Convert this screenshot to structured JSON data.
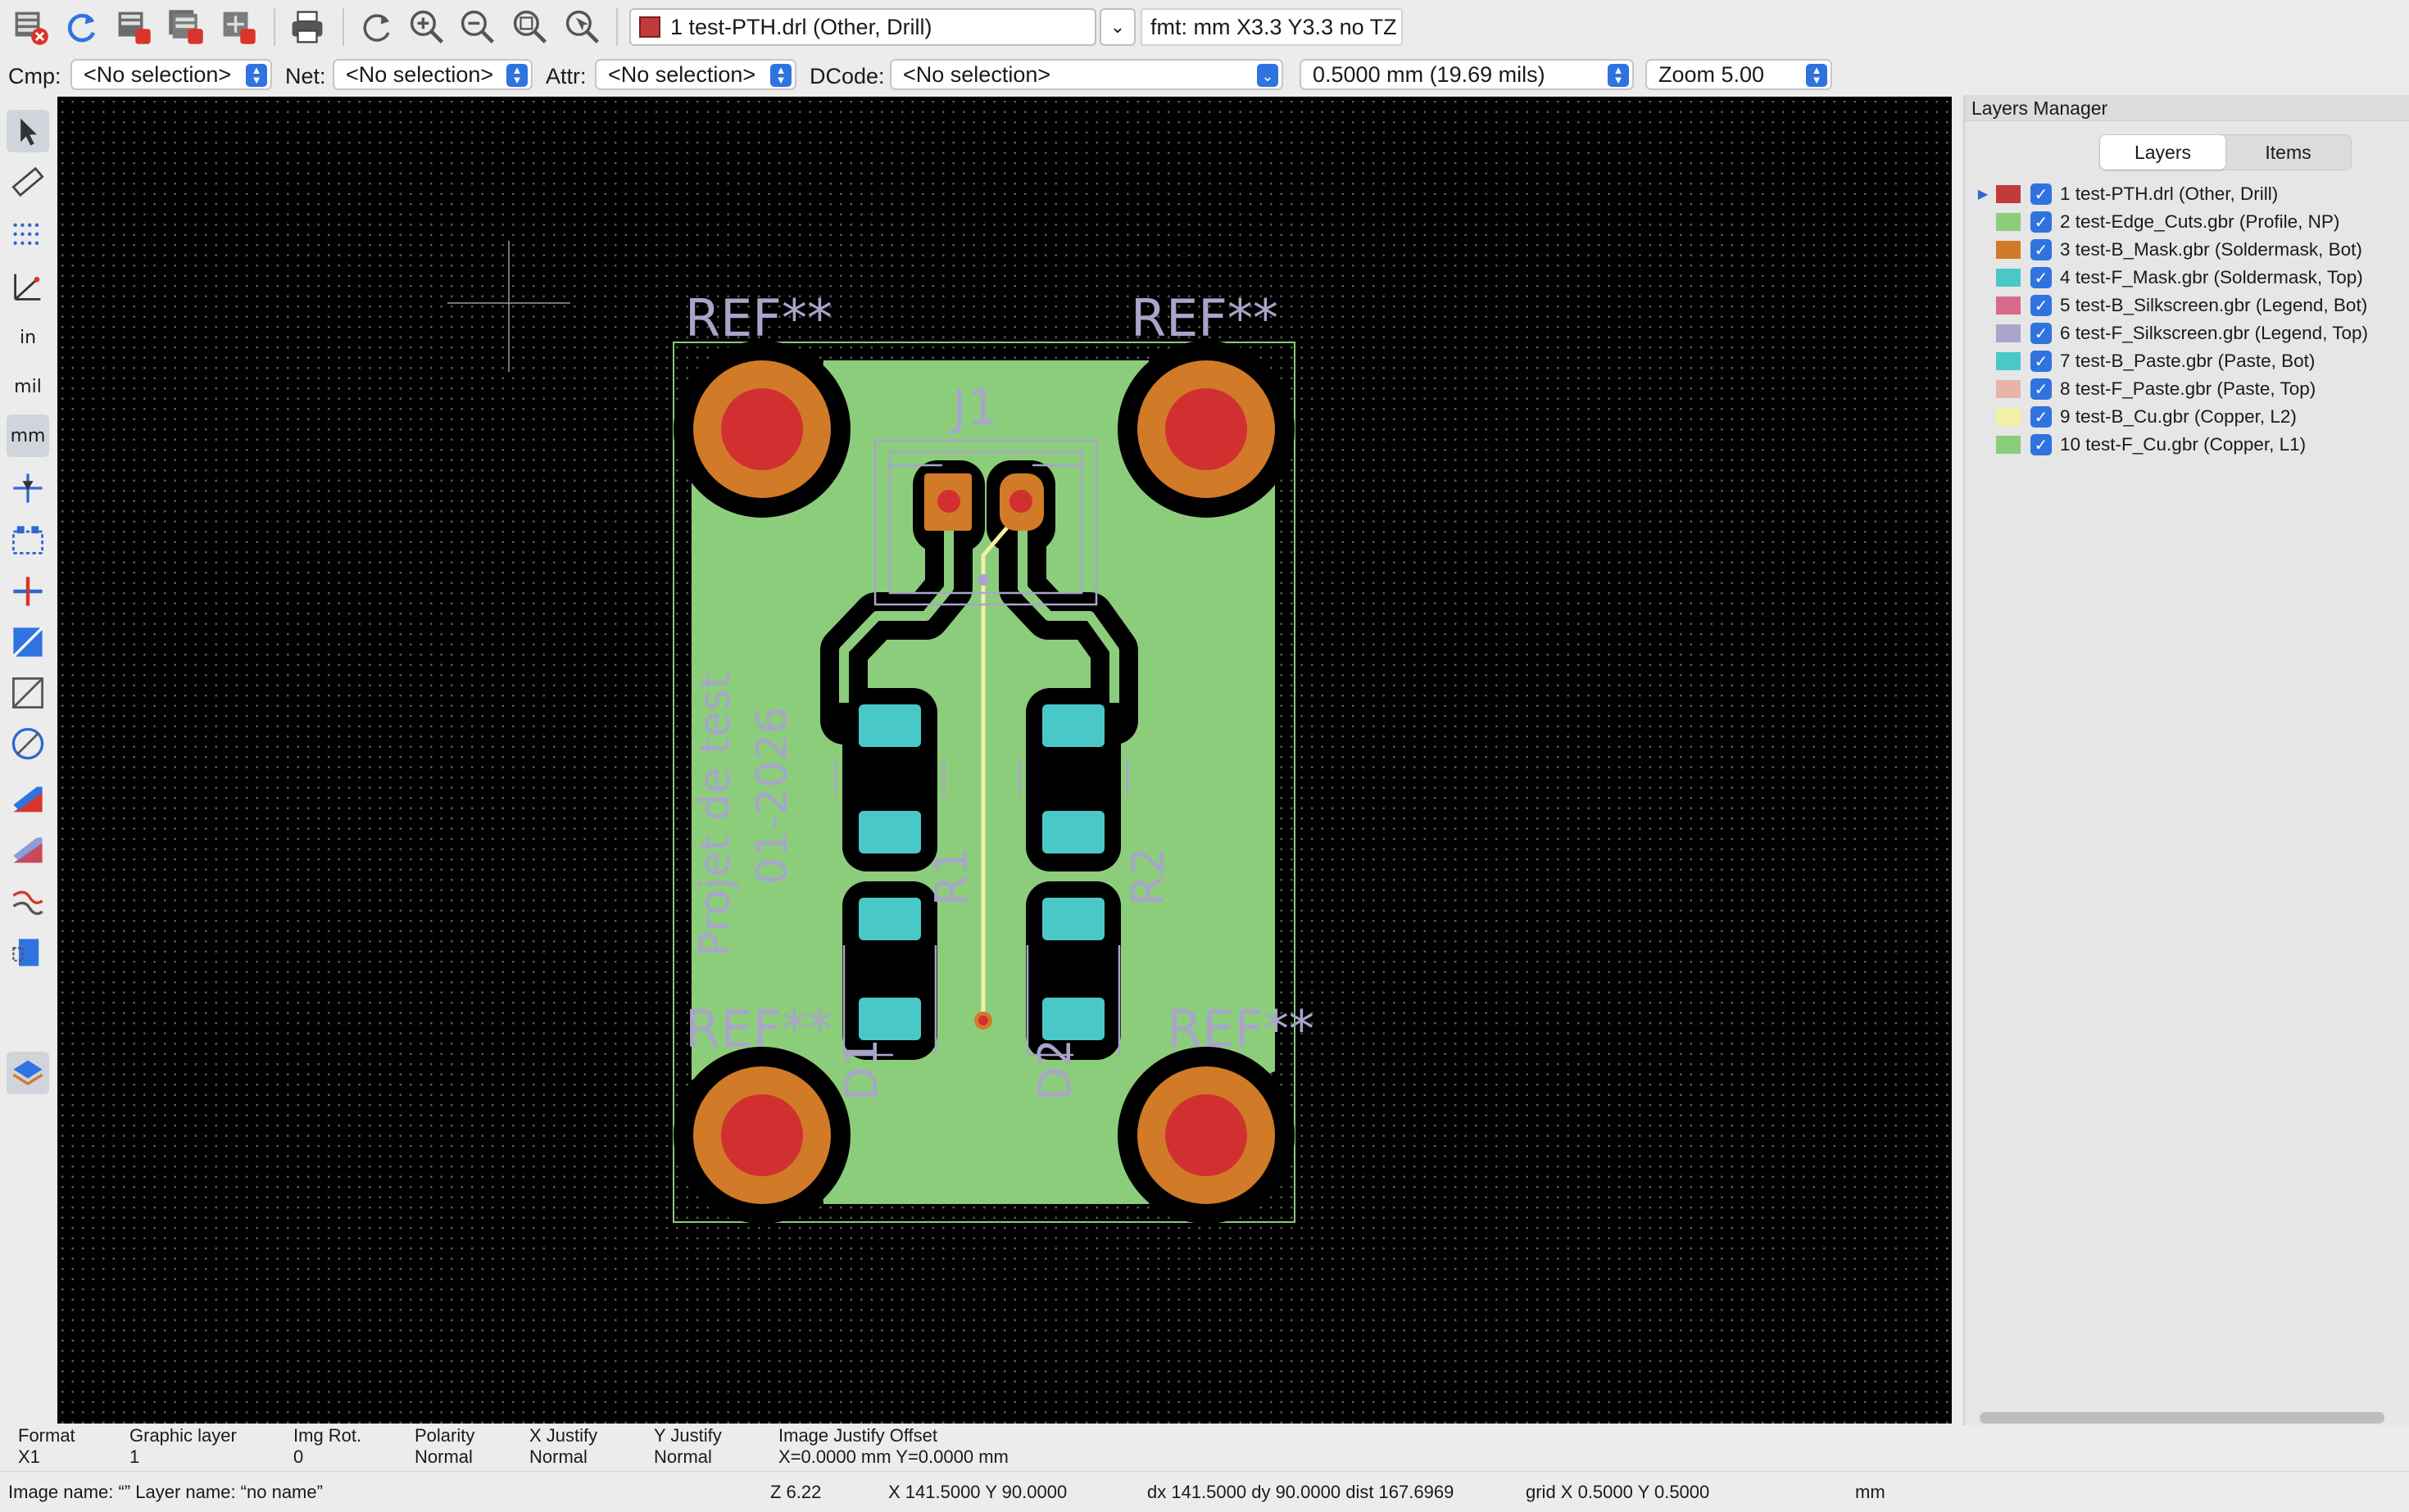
{
  "toolbar": {
    "layer_select": "1 test-PTH.drl (Other, Drill)",
    "layer_select_color": "#c23b3b",
    "format_info": "fmt: mm X3.3 Y3.3 no TZ",
    "icons": [
      "clear-and-load-icon",
      "reload-icon",
      "close-layer-icon",
      "close-all-layers-icon",
      "plot-icon",
      "print-icon",
      "redraw-icon",
      "zoom-in-icon",
      "zoom-out-icon",
      "zoom-fit-icon",
      "zoom-selection-icon"
    ]
  },
  "selbar": {
    "cmp_label": "Cmp:",
    "cmp_value": "<No selection>",
    "net_label": "Net:",
    "net_value": "<No selection>",
    "attr_label": "Attr:",
    "attr_value": "<No selection>",
    "dcode_label": "DCode:",
    "dcode_value": "<No selection>",
    "grid_value": "0.5000 mm (19.69 mils)",
    "zoom_value": "Zoom 5.00"
  },
  "left_toolbar": {
    "units_in": "in",
    "units_mil": "mil",
    "units_mm": "mm",
    "icons": [
      "select-arrow-icon",
      "measure-ruler-icon",
      "grid-dots-icon",
      "polar-coords-icon",
      "inches-icon",
      "mils-icon",
      "millimeters-icon",
      "cursor-crosshair-icon",
      "dcode-icon",
      "negative-objects-icon",
      "flashed-items-icon",
      "lines-sketch-icon",
      "polygons-sketch-icon",
      "diff-mode-icon",
      "transparency-icon",
      "show-layer-icon",
      "show-dcode-icon",
      "layers-manager-icon"
    ]
  },
  "pcb": {
    "ref_tl": "REF**",
    "ref_tr": "REF**",
    "ref_bl": "REF**",
    "ref_br": "REF**",
    "j1": "J1",
    "r1": "R1",
    "r2": "R2",
    "d1": "D1",
    "d2": "D2",
    "project_line1": "Projet de test",
    "project_line2": "01-2026",
    "colors": {
      "drill": "#d23030",
      "edge": "#8ccd7c",
      "bmask": "#d17a28",
      "fmask": "#4ac8c8",
      "silk": "#a8a5c9",
      "bcu": "#f2f0a6",
      "fcu": "#8ccd7c"
    }
  },
  "layers_manager": {
    "title": "Layers Manager",
    "tab_layers": "Layers",
    "tab_items": "Items",
    "layers": [
      {
        "label": "1 test-PTH.drl (Other, Drill)",
        "color": "#c23b3b",
        "active": true
      },
      {
        "label": "2 test-Edge_Cuts.gbr (Profile, NP)",
        "color": "#8ccd7c",
        "active": false
      },
      {
        "label": "3 test-B_Mask.gbr (Soldermask, Bot)",
        "color": "#d17a28",
        "active": false
      },
      {
        "label": "4 test-F_Mask.gbr (Soldermask, Top)",
        "color": "#4ac8c8",
        "active": false
      },
      {
        "label": "5 test-B_Silkscreen.gbr (Legend, Bot)",
        "color": "#d96a8c",
        "active": false
      },
      {
        "label": "6 test-F_Silkscreen.gbr (Legend, Top)",
        "color": "#a8a5c9",
        "active": false
      },
      {
        "label": "7 test-B_Paste.gbr (Paste, Bot)",
        "color": "#4ac8c8",
        "active": false
      },
      {
        "label": "8 test-F_Paste.gbr (Paste, Top)",
        "color": "#e8b4a8",
        "active": false
      },
      {
        "label": "9 test-B_Cu.gbr (Copper, L2)",
        "color": "#f2f0a6",
        "active": false
      },
      {
        "label": "10 test-F_Cu.gbr (Copper, L1)",
        "color": "#8ccd7c",
        "active": false
      }
    ]
  },
  "status_info": {
    "format_h": "Format",
    "format_v": "X1",
    "glayer_h": "Graphic layer",
    "glayer_v": "1",
    "imgrot_h": "Img Rot.",
    "imgrot_v": "0",
    "polarity_h": "Polarity",
    "polarity_v": "Normal",
    "xjust_h": "X Justify",
    "xjust_v": "Normal",
    "yjust_h": "Y Justify",
    "yjust_v": "Normal",
    "offset_h": "Image Justify Offset",
    "offset_v": "X=0.0000 mm Y=0.0000 mm"
  },
  "status_bar": {
    "image_name": "Image name: “”  Layer name: “no name”",
    "zoom": "Z 6.22",
    "coords": "X 141.5000  Y 90.0000",
    "delta": "dx 141.5000  dy 90.0000  dist 167.6969",
    "grid": "grid X 0.5000  Y 0.5000",
    "units": "mm"
  }
}
